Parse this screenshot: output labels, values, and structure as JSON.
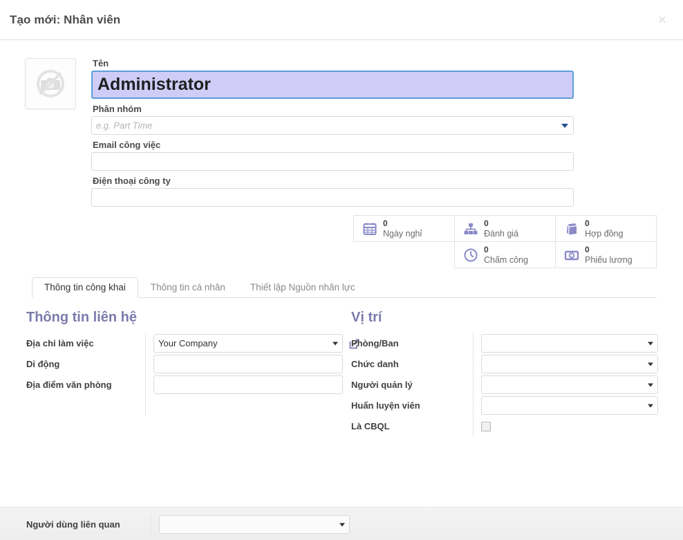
{
  "dialog": {
    "title": "Tạo mới: Nhân viên",
    "close_label": "×"
  },
  "avatar": {
    "icon": "no-image-camera-icon"
  },
  "top_fields": [
    {
      "label": "Tên",
      "value": "Administrator",
      "placeholder": "",
      "type": "text-large"
    },
    {
      "label": "Phân nhóm",
      "value": "",
      "placeholder": "e.g. Part Time",
      "type": "select"
    },
    {
      "label": "Email công việc",
      "value": "",
      "placeholder": "",
      "type": "text"
    },
    {
      "label": "Điện thoại công ty",
      "value": "",
      "placeholder": "",
      "type": "text"
    }
  ],
  "stat_buttons": [
    {
      "value": "0",
      "label": "Ngày nghỉ",
      "icon": "calendar-icon"
    },
    {
      "value": "0",
      "label": "Đánh giá",
      "icon": "sitemap-icon"
    },
    {
      "value": "0",
      "label": "Hợp đồng",
      "icon": "book-icon"
    },
    {
      "value": "0",
      "label": "Chấm công",
      "icon": "clock-icon"
    },
    {
      "value": "0",
      "label": "Phiếu lương",
      "icon": "banknote-icon"
    }
  ],
  "tabs": [
    {
      "label": "Thông tin công khai",
      "active": true
    },
    {
      "label": "Thông tin cá nhân",
      "active": false
    },
    {
      "label": "Thiết lập Nguồn nhân lực",
      "active": false
    }
  ],
  "left_section": {
    "title": "Thông tin liên hệ",
    "rows": [
      {
        "label": "Địa chỉ làm việc",
        "value": "Your Company",
        "type": "select",
        "link_icon": "external-link-icon"
      },
      {
        "label": "Di động",
        "value": "",
        "type": "text"
      },
      {
        "label": "Địa điểm văn phòng",
        "value": "",
        "type": "text"
      }
    ]
  },
  "right_section": {
    "title": "Vị trí",
    "rows": [
      {
        "label": "Phòng/Ban",
        "value": "",
        "type": "select"
      },
      {
        "label": "Chức danh",
        "value": "",
        "type": "select"
      },
      {
        "label": "Người quản lý",
        "value": "",
        "type": "select"
      },
      {
        "label": "Huấn luyện viên",
        "value": "",
        "type": "select"
      },
      {
        "label": "Là CBQL",
        "value": "",
        "type": "checkbox",
        "checked": false
      }
    ]
  },
  "bottom_row": {
    "label": "Người dùng liên quan",
    "value": "",
    "type": "select"
  },
  "colors": {
    "accent_purple": "#7c7bad",
    "icon_purple": "#8a8ac8",
    "focus_border": "#5c9ddb",
    "focus_bg": "#cfcdf7",
    "caret_blue": "#1c4f93",
    "border_gray": "#d9d9d9",
    "label_gray": "#4a4a4a"
  }
}
